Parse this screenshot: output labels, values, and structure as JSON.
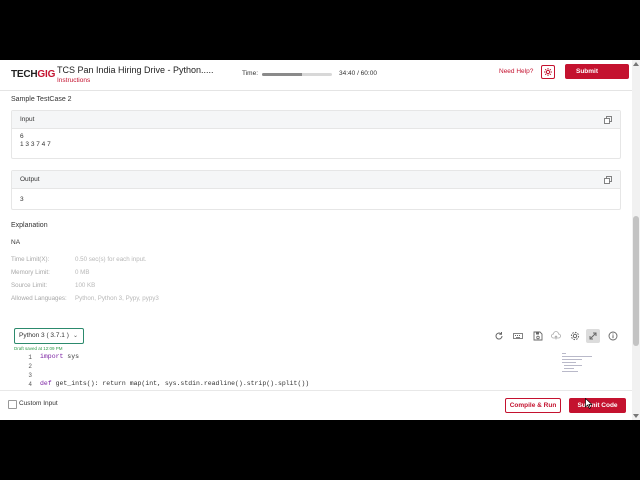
{
  "header": {
    "logo_tech": "TECH",
    "logo_gig": "GIG",
    "title": "TCS Pan India Hiring Drive - Python.....",
    "subtitle": "Instructions",
    "time_label": "Time:",
    "time_value": "34:40 / 60:00",
    "time_progress": 0.578,
    "help": "Need Help?",
    "submit": "Submit"
  },
  "testcase": {
    "title": "Sample TestCase 2",
    "input_label": "Input",
    "input_value": "6\n1 3 3 7 4 7",
    "output_label": "Output",
    "output_value": "3"
  },
  "explanation": {
    "title": "Explanation",
    "text": "NA"
  },
  "limits": [
    {
      "label": "Time Limit(X):",
      "value": "0.50 sec(s) for each input."
    },
    {
      "label": "Memory Limit:",
      "value": "0 MB"
    },
    {
      "label": "Source Limit:",
      "value": "100 KB"
    },
    {
      "label": "Allowed Languages:",
      "value": "Python, Python 3, Pypy, pypy3"
    }
  ],
  "editor": {
    "language": "Python 3 ( 3.7.1 )",
    "draft": "Draft saved at 12:09 PM",
    "lines": [
      "1",
      "2",
      "3",
      "4"
    ],
    "code_l1_kw": "import",
    "code_l1_rest": " sys",
    "code_l4_kw": "def",
    "code_l4_rest": " get_ints(): return map(int, sys.stdin.readline().strip().split())"
  },
  "footer": {
    "custom_input": "Custom Input",
    "compile": "Compile & Run",
    "submit_code": "Submit Code"
  },
  "colors": {
    "brand": "#c4122f",
    "accent_green": "#2c8a6d"
  }
}
